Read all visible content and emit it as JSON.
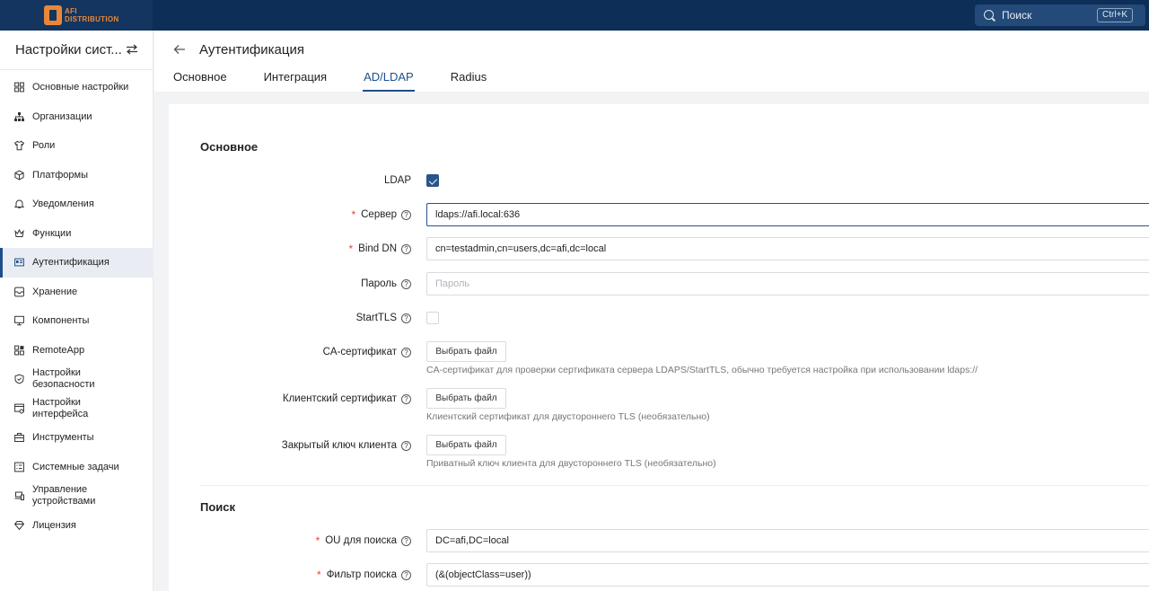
{
  "header": {
    "logo_text_1": "AFI",
    "logo_text_2": "DISTRIBUTION",
    "search_label": "Поиск",
    "search_shortcut": "Ctrl+K"
  },
  "sidebar": {
    "title": "Настройки сист...",
    "items": [
      {
        "label": "Основные настройки",
        "icon": "grid-icon"
      },
      {
        "label": "Организации",
        "icon": "org-icon"
      },
      {
        "label": "Роли",
        "icon": "shirt-icon"
      },
      {
        "label": "Платформы",
        "icon": "cube-icon"
      },
      {
        "label": "Уведомления",
        "icon": "bell-icon"
      },
      {
        "label": "Функции",
        "icon": "crown-icon"
      },
      {
        "label": "Аутентификация",
        "icon": "id-card-icon",
        "active": true
      },
      {
        "label": "Хранение",
        "icon": "storage-icon"
      },
      {
        "label": "Компоненты",
        "icon": "monitor-icon"
      },
      {
        "label": "RemoteApp",
        "icon": "apps-icon"
      },
      {
        "label": "Настройки безопасности",
        "icon": "shield-icon"
      },
      {
        "label": "Настройки интерфейса",
        "icon": "interface-icon"
      },
      {
        "label": "Инструменты",
        "icon": "toolbox-icon"
      },
      {
        "label": "Системные задачи",
        "icon": "tasks-icon"
      },
      {
        "label": "Управление устройствами",
        "icon": "devices-icon"
      },
      {
        "label": "Лицензия",
        "icon": "license-icon"
      }
    ]
  },
  "page": {
    "title": "Аутентификация",
    "tabs": [
      "Основное",
      "Интеграция",
      "AD/LDAP",
      "Radius"
    ],
    "active_tab": "AD/LDAP"
  },
  "form": {
    "section_main": "Основное",
    "ldap_label": "LDAP",
    "ldap_checked": true,
    "server_label": "Сервер",
    "server_value": "ldaps://afi.local:636",
    "bind_dn_label": "Bind DN",
    "bind_dn_value": "cn=testadmin,cn=users,dc=afi,dc=local",
    "password_label": "Пароль",
    "password_placeholder": "Пароль",
    "starttls_label": "StartTLS",
    "starttls_checked": false,
    "ca_label": "CA-сертификат",
    "ca_button": "Выбрать файл",
    "ca_hint": "CA-сертификат для проверки сертификата сервера LDAPS/StartTLS, обычно требуется настройка при использовании ldaps://",
    "client_cert_label": "Клиентский сертификат",
    "client_cert_button": "Выбрать файл",
    "client_cert_hint": "Клиентский сертификат для двустороннего TLS (необязательно)",
    "client_key_label": "Закрытый ключ клиента",
    "client_key_button": "Выбрать файл",
    "client_key_hint": "Приватный ключ клиента для двустороннего TLS (необязательно)",
    "section_search": "Поиск",
    "ou_label": "OU для поиска",
    "ou_value": "DC=afi,DC=local",
    "filter_label": "Фильтр поиска",
    "filter_value": "(&(objectClass=user))"
  },
  "colors": {
    "topbar": "#0d2e57",
    "accent": "#1f4f8b",
    "required": "#e2453a",
    "logo": "#e8873a"
  }
}
